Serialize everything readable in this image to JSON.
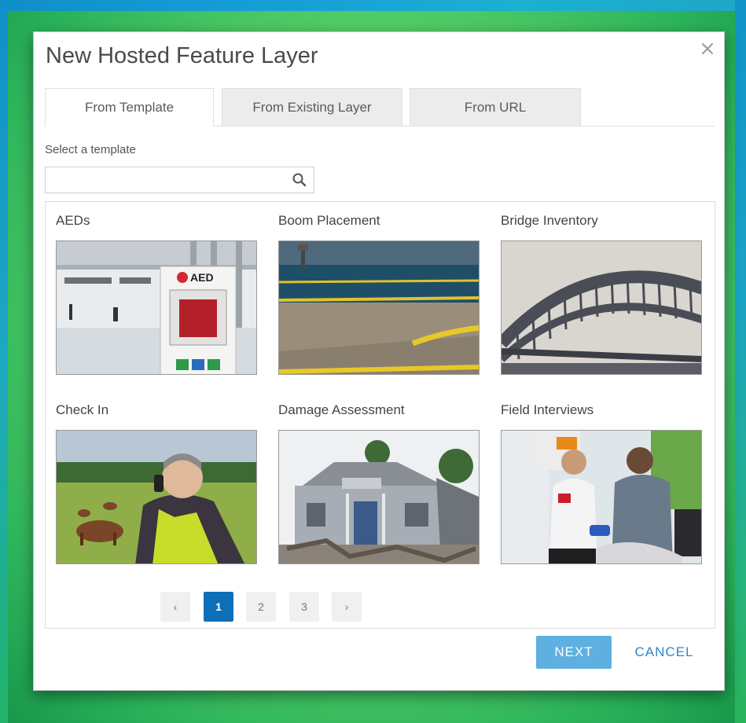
{
  "dialog": {
    "title": "New Hosted Feature Layer",
    "close_icon": "close-icon"
  },
  "tabs": [
    {
      "label": "From Template",
      "active": true
    },
    {
      "label": "From Existing Layer",
      "active": false
    },
    {
      "label": "From URL",
      "active": false
    }
  ],
  "template_select": {
    "label": "Select a template",
    "search": {
      "value": "",
      "placeholder": "",
      "icon": "search-icon"
    }
  },
  "templates": [
    {
      "title": "AEDs",
      "thumb_text": "AED"
    },
    {
      "title": "Boom Placement"
    },
    {
      "title": "Bridge Inventory"
    },
    {
      "title": "Check In"
    },
    {
      "title": "Damage Assessment"
    },
    {
      "title": "Field Interviews"
    }
  ],
  "pagination": {
    "prev": "‹",
    "pages": [
      "1",
      "2",
      "3"
    ],
    "current": "1",
    "next": "›"
  },
  "footer": {
    "next_label": "NEXT",
    "cancel_label": "CANCEL"
  },
  "colors": {
    "accent": "#0d6fb8",
    "next_button": "#5fb0e0",
    "cancel_text": "#2f86c8"
  }
}
